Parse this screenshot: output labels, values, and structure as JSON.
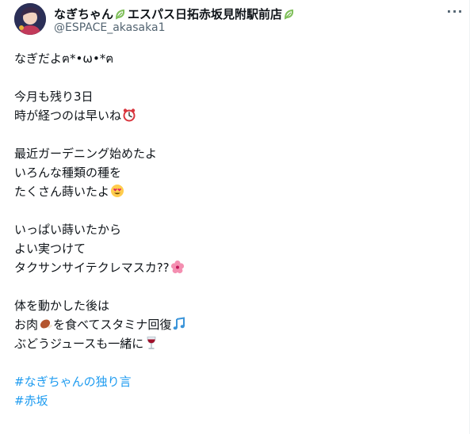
{
  "post": {
    "display_name_a": "なぎちゃん",
    "display_name_b": "エスパス日拓赤坂見附駅前店",
    "handle": "@ESPACE_akasaka1",
    "more_label": "···",
    "lines": {
      "l1": "なぎだよฅ*•ω•*ฅ",
      "l2": "今月も残り3日",
      "l3": "時が経つのは早いね",
      "l4": "最近ガーデニング始めたよ",
      "l5": "いろんな種類の種を",
      "l6": "たくさん蒔いたよ",
      "l7": "いっぱい蒔いたから",
      "l8": "よい実つけて",
      "l9": "タクサンサイテクレマスカ??",
      "l10": "体を動かした後は",
      "l11a": "お肉",
      "l11b": "を食べてスタミナ回復",
      "l12": "ぶどうジュースも一緒に"
    },
    "hashtags": [
      "#なぎちゃんの独り言",
      "#赤坂"
    ]
  },
  "colors": {
    "accent": "#1d9bf0",
    "text": "#0f1419",
    "muted": "#536471",
    "leaf_green": "#7fbf5a"
  },
  "icons": [
    "avatar",
    "leaf-icon",
    "alarm-clock-icon",
    "heart-eyes-icon",
    "hibiscus-icon",
    "meat-icon",
    "music-notes-icon",
    "wine-glass-icon",
    "more-icon"
  ]
}
